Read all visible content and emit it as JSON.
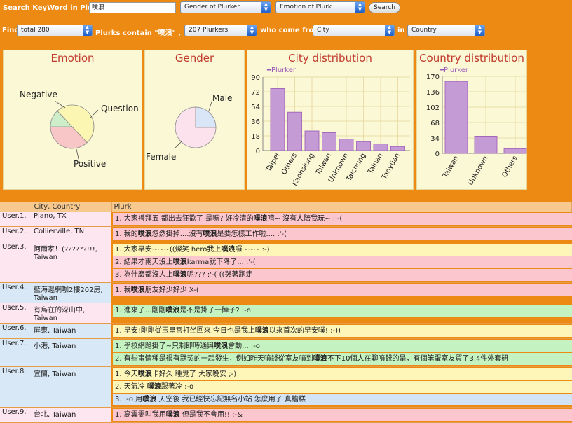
{
  "search": {
    "label": "Search KeyWord in Plurks :",
    "keyword": "噗浪",
    "gender_select": "Gender of Plurker",
    "emotion_select": "Emotion of Plurk",
    "button": "Search"
  },
  "filter": {
    "find_label": "Find",
    "total_select": "total 280",
    "contain_prefix": "Plurks contain \"",
    "contain_keyword": "噗浪",
    "contain_suffix": "\" , by",
    "plurkers_select": "207 Plurkers",
    "who_label": "who come from",
    "city_select": "City",
    "in_label": "in",
    "country_select": "Country"
  },
  "charts": {
    "emotion": {
      "title": "Emotion",
      "labels": [
        "Negative",
        "Question",
        "Positive"
      ]
    },
    "gender": {
      "title": "Gender",
      "labels": [
        "Male",
        "Female"
      ]
    }
  },
  "chart_data": [
    {
      "type": "pie",
      "title": "Emotion",
      "slices": [
        {
          "label": "Negative",
          "value": 0.37,
          "color": "#f8c6c6"
        },
        {
          "label": "Question",
          "value": 0.13,
          "color": "#cdeec8"
        },
        {
          "label": "Positive",
          "value": 0.5,
          "color": "#fbf6b2"
        }
      ]
    },
    {
      "type": "pie",
      "title": "Gender",
      "slices": [
        {
          "label": "Male",
          "value": 0.25,
          "color": "#d8e6f7"
        },
        {
          "label": "Female",
          "value": 0.75,
          "color": "#fbe2ec"
        }
      ]
    },
    {
      "type": "bar",
      "title": "City distribution",
      "legend": "Plurker",
      "categories": [
        "Taipei",
        "Others",
        "Kaohsiung",
        "Taiwan",
        "Unknown",
        "Taichung",
        "Tainan",
        "Taoyüan"
      ],
      "values": [
        76,
        47,
        24,
        22,
        14,
        11,
        8,
        5
      ],
      "yticks": [
        0,
        18,
        36,
        54,
        72,
        90
      ],
      "ylim": [
        0,
        90
      ],
      "color": "#c59bd6"
    },
    {
      "type": "bar",
      "title": "Country distribution",
      "legend": "Plurker",
      "categories": [
        "Taiwan",
        "Unknown",
        "Others"
      ],
      "values": [
        159,
        38,
        10
      ],
      "yticks": [
        0,
        34,
        68,
        102,
        136,
        170
      ],
      "ylim": [
        0,
        170
      ],
      "color": "#c59bd6"
    }
  ],
  "table": {
    "headers": [
      "",
      "City, Country",
      "Plurk"
    ],
    "rows": [
      {
        "user": "User.1.",
        "location": "Plano, TX",
        "color": "pink",
        "plurks": [
          {
            "pre": "1. 大家禮拜五 都出去狂歡了 是嗎? 好冷清的",
            "kw": "噗浪",
            "post": "唷~ 沒有人陪我玩~ :'-(",
            "tone": "pink"
          }
        ]
      },
      {
        "user": "User.2.",
        "location": "Collierville, TN",
        "color": "pink",
        "plurks": [
          {
            "pre": "1. 我的",
            "kw": "噗浪",
            "post": "忽然掛掉....沒有",
            "kw2": "噗浪",
            "post2": "是要怎樣工作啦.... :'-(",
            "tone": "pink"
          }
        ]
      },
      {
        "user": "User.3.",
        "location": "阿爾家！(??????!!!, Taiwan",
        "color": "pink",
        "plurks": [
          {
            "pre": "1. 大家早安~~~((燦笑 hero我上",
            "kw": "噗浪",
            "post": "囉~~~ :-)",
            "tone": "yellow"
          },
          {
            "pre": "2. 結果才兩天沒上",
            "kw": "噗浪",
            "post": "karma就下降了... :'-(",
            "tone": "pink"
          },
          {
            "pre": "3. 為什麼都沒人上",
            "kw": "噗浪",
            "post": "呢??? :'-( ((哭著跑走",
            "tone": "pink"
          }
        ]
      },
      {
        "user": "User.4.",
        "location": "藍海邊網咖2樓202房, Taiwan",
        "color": "blue",
        "plurks": [
          {
            "pre": "1. 我",
            "kw": "噗浪",
            "post": "朋友好少好少 X-(",
            "tone": "pink"
          }
        ]
      },
      {
        "user": "User.5.",
        "location": "有烏在的深山中, Taiwan",
        "color": "pink",
        "plurks": [
          {
            "pre": "1. 進來了...剛剛",
            "kw": "噗浪",
            "post": "是不是掛了一陣子? :-o",
            "tone": "green"
          }
        ]
      },
      {
        "user": "User.6.",
        "location": "屏東, Taiwan",
        "color": "blue",
        "plurks": [
          {
            "pre": "1. 早安!剛剛從玉皇宮打坐回來,今日也是我上",
            "kw": "噗浪",
            "post": "以來首次的早安噗! :-))",
            "tone": "yellow"
          }
        ]
      },
      {
        "user": "User.7.",
        "location": "小港, Taiwan",
        "color": "blue",
        "plurks": [
          {
            "pre": "1. 學校網路掛了~只剩即時通與",
            "kw": "噗浪",
            "post": "會動... :-o",
            "tone": "green"
          },
          {
            "pre": "2. 有些事情種是很有默契的一起發生，例如昨天噴錢從室友噴到",
            "kw": "噗浪",
            "post": "不下10個人在聊噴錢的是，有個笨蛋室友買了3.4件外套研",
            "tone": "green"
          }
        ]
      },
      {
        "user": "User.8.",
        "location": "宜蘭, Taiwan",
        "color": "blue",
        "plurks": [
          {
            "pre": "1. 今天",
            "kw": "噗浪",
            "post": "卡好久 睡覺了 大家晚安 ;-)",
            "tone": "yellow"
          },
          {
            "pre": "2. 天氣冷 ",
            "kw": "噗浪",
            "post": "跟著冷 :-o",
            "tone": "yellow"
          },
          {
            "pre": "3. :-o 用",
            "kw": "噗浪",
            "post": " 天空後 我已經快忘記無名小站 怎麼用了 真糟糕",
            "tone": "blue"
          }
        ]
      },
      {
        "user": "User.9.",
        "location": "台北, Taiwan",
        "color": "pink",
        "plurks": [
          {
            "pre": "1. 高雲雯叫我用",
            "kw": "噗浪",
            "post": " 但是我不會用!! :-&",
            "tone": "pink"
          }
        ]
      }
    ]
  }
}
